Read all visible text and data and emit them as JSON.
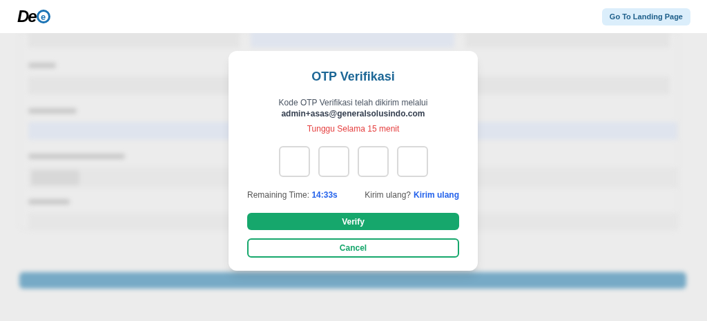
{
  "header": {
    "logo": {
      "text": "De",
      "badge": "e"
    },
    "landing_button": "Go To Landing Page"
  },
  "background": {
    "kind": "blurred-form"
  },
  "modal": {
    "title": "OTP Verifikasi",
    "message": "Kode OTP Verifikasi telah dikirim melalui",
    "email": "admin+asas@generalsolusindo.com",
    "wait_notice": "Tunggu Selama 15 menit",
    "otp_fields": [
      {
        "kind": "digit"
      },
      {
        "kind": "digit"
      },
      {
        "kind": "digit"
      },
      {
        "kind": "digit"
      }
    ],
    "remaining_label": "Remaining Time:",
    "remaining_value": "14:33s",
    "resend_prompt": "Kirim ulang?",
    "resend_link": "Kirim ulang",
    "verify_button": "Verify",
    "cancel_button": "Cancel"
  }
}
